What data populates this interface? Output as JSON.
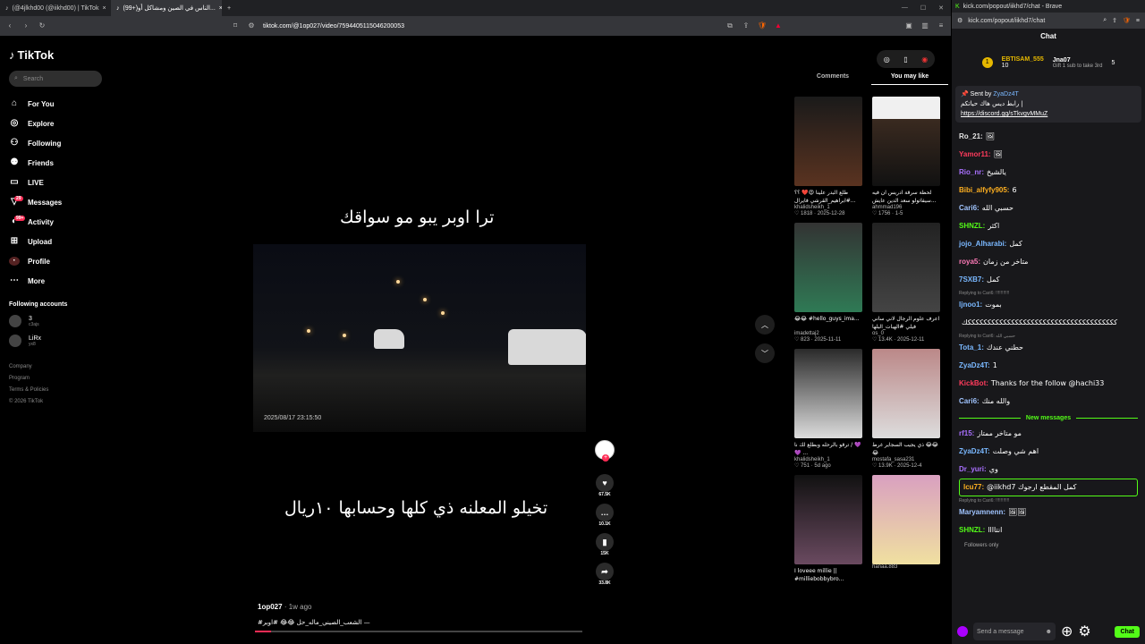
{
  "browser_left": {
    "tabs": [
      {
        "label": "(@4jlkhd00 (@iikhd00) | TikTok",
        "active": false
      },
      {
        "label": "(99+)الناس في الصين ومشاكل أو...",
        "active": true
      }
    ],
    "url": "tiktok.com/@1op027/video/7594405115046200053"
  },
  "tiktok": {
    "logo": "TikTok",
    "search_placeholder": "Search",
    "nav": [
      {
        "label": "For You",
        "icon": "home-icon"
      },
      {
        "label": "Explore",
        "icon": "compass-icon"
      },
      {
        "label": "Following",
        "icon": "following-icon"
      },
      {
        "label": "Friends",
        "icon": "friends-icon"
      },
      {
        "label": "LIVE",
        "icon": "live-icon"
      },
      {
        "label": "Messages",
        "icon": "messages-icon",
        "badge": "29"
      },
      {
        "label": "Activity",
        "icon": "activity-icon",
        "badge": "99+"
      },
      {
        "label": "Upload",
        "icon": "upload-icon"
      },
      {
        "label": "Profile",
        "icon": "profile-icon"
      },
      {
        "label": "More",
        "icon": "more-icon"
      }
    ],
    "following_title": "Following accounts",
    "accounts": [
      {
        "name": "3",
        "handle": "c3ajs"
      },
      {
        "name": "LiRx",
        "handle": "yx8"
      }
    ],
    "footer": [
      "Company",
      "Program",
      "Terms & Policies",
      "© 2026 TikTok"
    ],
    "video": {
      "caption_top": "ترا اوبر يبو مو سواقك",
      "caption_bottom": "تخيلو المعلنه ذي كلها وحسابها ١٠ريال",
      "timestamp": "2025/08/17 23:15:50",
      "author": "1op027",
      "posted": "· 1w ago",
      "description": "#الشعب_الصيني_ماله_حل 😂😂 #اوبر —",
      "progress": 0.05,
      "likes": "67.5K",
      "comments": "10.1K",
      "saves": "15K",
      "shares": "33.8K"
    },
    "panel": {
      "tabs": [
        "Comments",
        "You may like"
      ],
      "items": [
        {
          "title": "طلع البدر علينا 😍❤️ ؟؟ #ابراهيم_القرشي فايرال...",
          "user": "khalidsheikh_1",
          "meta": "♡ 1818 · 2025-12-28"
        },
        {
          "title": "لحظة سرقة ادريس ان فيه سيفاتولو سعد الدين عايش...",
          "user": "ahmmad196",
          "meta": "♡ 1756 · 1-5"
        },
        {
          "title": "😂😂 #hello_guys_ima...",
          "user": "imadettaj2",
          "meta": "♡ 823 · 2025-11-11"
        },
        {
          "title": "اعرف علوم الرجال لاني ساني فيلي #الهبات_البلها",
          "user": "os_0",
          "meta": "♡ 13.4K · 2025-12-11"
        },
        {
          "title": "ترقو بالرحله وبطلع لك نا / 💜💜 ...",
          "user": "khalidsheikh_1",
          "meta": "♡ 751 · 5d ago"
        },
        {
          "title": "ذي يجيب السجاير غرط 😂😂😂",
          "user": "mostafa_sasa231",
          "meta": "♡ 13.9K · 2025-12-4"
        },
        {
          "title": "I loveee millie || #milliebobbybro...",
          "user": "",
          "meta": ""
        },
        {
          "title": "",
          "user": "hanaa.883",
          "meta": ""
        }
      ]
    }
  },
  "kick": {
    "window_title": "kick.com/popout/iikhd7/chat - Brave",
    "url": "kick.com/popout/iikhd7/chat",
    "header": "Chat",
    "leader": {
      "user": "EBTISAM_555",
      "count": "10",
      "second": "Jna07",
      "second_count": "5",
      "gift": "Gift 1 sub to take 3rd"
    },
    "pinned": {
      "sent_by": "Sent by",
      "author": "ZyaDz4T",
      "text": "رابط ديس هاك حياتكم |",
      "link": "https://discord.gg/sTkvgvMMuZ"
    },
    "messages": [
      {
        "user": "Ro_21:",
        "color": "#e5e5e5",
        "text": "🖼"
      },
      {
        "user": "Yamor11:",
        "color": "#ff3b5c",
        "text": "🖼"
      },
      {
        "user": "Rio_nr:",
        "color": "#a970ff",
        "text": "يالشيخ"
      },
      {
        "user": "Bibi_alfyfy905:",
        "color": "#ffb020",
        "text": "6"
      },
      {
        "user": "Cari6:",
        "color": "#a0c4ff",
        "text": "حسبي الله"
      },
      {
        "user": "SHNZL:",
        "color": "#53fc18",
        "text": "اكثر"
      },
      {
        "user": "jojo_Alharabi:",
        "color": "#7ab8ff",
        "text": "كمل"
      },
      {
        "user": "roya5:",
        "color": "#ff7ab8",
        "text": "متاخر من زمان"
      },
      {
        "user": "7SXB7:",
        "color": "#7ab8ff",
        "text": "كمل"
      },
      {
        "user": "ljnoo1:",
        "color": "#7ab8ff",
        "text": "بموت",
        "reply": "Replying to Cari6: !!!!!!!!!!!"
      },
      {
        "user": "",
        "color": "#fff",
        "text": "ككككككككككككككككككككككككككككككككككككككك"
      },
      {
        "user": "Tota_1:",
        "color": "#7ab8ff",
        "text": "حطني عندك",
        "reply": "Replying to Cari6: حسبي الله"
      },
      {
        "user": "ZyaDz4T:",
        "color": "#7ab8ff",
        "text": "1"
      },
      {
        "user": "KickBot:",
        "color": "#ff3b5c",
        "text": "Thanks for the follow @hachi33"
      },
      {
        "user": "Cari6:",
        "color": "#a0c4ff",
        "text": "والله منك"
      },
      {
        "user": "rf15:",
        "color": "#a970ff",
        "text": "مو متاخر ممتاز",
        "new": true
      },
      {
        "user": "ZyaDz4T:",
        "color": "#7ab8ff",
        "text": "اهم شي وصلت"
      },
      {
        "user": "Dr_yuri:",
        "color": "#a970ff",
        "text": "وي"
      },
      {
        "user": "lcu77:",
        "color": "#ffb020",
        "text": "@iikhd7 كمل المقطع ارجوك",
        "highlight": true
      },
      {
        "user": "Maryamnenn:",
        "color": "#a0c4ff",
        "text": "🖼🖼",
        "reply": "Replying to Cari6: !!!!!!!!!!!"
      },
      {
        "user": "SHNZL:",
        "color": "#53fc18",
        "text": "انتاااا"
      }
    ],
    "new_messages_label": "New messages",
    "followers_only": "Followers only",
    "input_placeholder": "Send a message",
    "chat_button": "Chat"
  }
}
